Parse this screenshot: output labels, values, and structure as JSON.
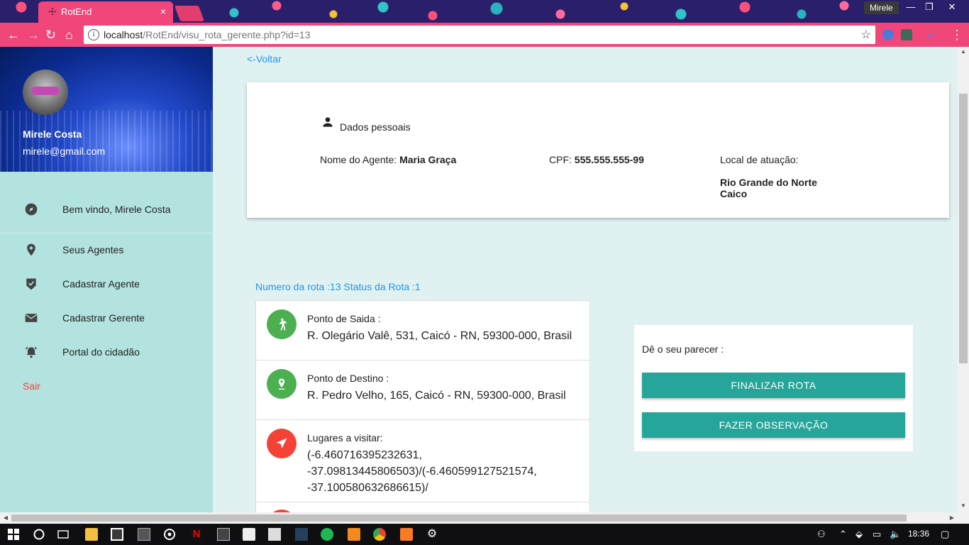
{
  "browser": {
    "tab_title": "RotEnd",
    "tab_close": "×",
    "url_host": "localhost",
    "url_path": "/RotEnd/visu_rota_gerente.php?id=13",
    "user_chip": "Mirele",
    "win_min": "—",
    "win_max": "❐",
    "win_close": "✕"
  },
  "profile": {
    "name": "Mirele Costa",
    "email": "mirele@gmail.com"
  },
  "sidebar": {
    "items": [
      {
        "label": "Bem vindo, Mirele Costa",
        "icon": "compass-icon"
      },
      {
        "label": "Seus Agentes",
        "icon": "add-location-icon"
      },
      {
        "label": "Cadastrar Agente",
        "icon": "verified-shield-icon"
      },
      {
        "label": "Cadastrar Gerente",
        "icon": "mail-icon"
      },
      {
        "label": "Portal do cidadão",
        "icon": "alarm-bell-icon"
      }
    ],
    "logout": "Sair"
  },
  "main": {
    "back_link": "<-Voltar",
    "personal": {
      "title": "Dados pessoais",
      "agent_label": "Nome do Agente: ",
      "agent_value": "Maria Graça",
      "cpf_label": "CPF: ",
      "cpf_value": "555.555.555-99",
      "location_label": "Local de atuação:",
      "location_state": "Rio Grande do Norte",
      "location_city": "Caico"
    },
    "route_header": "Numero da rota :13 Status da Rota :1",
    "route_items": [
      {
        "title": "Ponto de Saida :",
        "value": "R. Olegário Valê, 531, Caicó - RN, 59300-000, Brasil",
        "icon": "walk-icon",
        "color": "#4caf50"
      },
      {
        "title": "Ponto de Destino :",
        "value": "R. Pedro Velho, 165, Caicó - RN, 59300-000, Brasil",
        "icon": "pin-icon",
        "color": "#4caf50"
      },
      {
        "title": "Lugares a visitar:",
        "value": "(-6.460716395232631, -37.09813445806503)/(-6.460599127521574, -37.100580632686615)/",
        "icon": "navigation-arrow-icon",
        "color": "#f44336"
      }
    ],
    "action": {
      "prompt": "Dê o seu parecer :",
      "finish_button": "FINALIZAR ROTA",
      "observe_button": "FAZER OBSERVAÇÃO"
    }
  },
  "taskbar": {
    "clock": "18:36"
  },
  "colors": {
    "accent_teal": "#26a69a",
    "link_blue": "#2196f3",
    "sidebar_bg": "#b2e3df",
    "danger": "#f44336",
    "success": "#4caf50",
    "browser_pink": "#f0467a"
  }
}
